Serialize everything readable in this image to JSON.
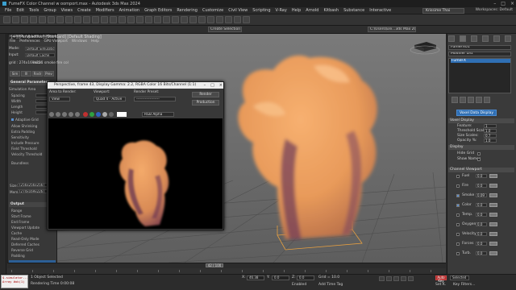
{
  "app": {
    "title": "FumeFX Color Channel w oomport.max - Autodesk 3ds Max 2024",
    "menu": [
      "File",
      "Edit",
      "Tools",
      "Group",
      "Views",
      "Create",
      "Modifiers",
      "Animation",
      "Graph Editors",
      "Rendering",
      "Customize",
      "Civil View",
      "Scripting",
      "V-Ray",
      "Help",
      "Arnold",
      "Kitbash",
      "Substance",
      "Interactive"
    ],
    "signin": "Krissime Thai",
    "workspace": "Workspaces: Default",
    "selection_set": "Create Selection Se",
    "project_path": "C:\\Users\\Ele...3ds Max 2024"
  },
  "viewport": {
    "label": "[+] [Perspective] [Standard] [Default Shading]"
  },
  "fumefx": {
    "title": "FumeFX 7.0 Core | FumeFX01",
    "menu": [
      "File",
      "Preferences",
      "GPU Viewport",
      "Windows",
      "Help"
    ],
    "mode_label": "Mode:",
    "mode_value": "Default Simulation",
    "input_label": "Input:",
    "input_value": "Default Cache",
    "grid_info": "grid : 274x169x226",
    "data_label": "data : smoke fire col",
    "tabs": [
      "Sim",
      "Ill",
      "Rndr",
      "Prev"
    ],
    "section_general": "General Parameters",
    "sim_area_label": "Simulation Area",
    "params": [
      "Spacing",
      "Width",
      "Length",
      "Height"
    ],
    "adaptive": "Adaptive Grid",
    "params2": [
      "Allow Shrinking",
      "Extra Padding",
      "Sensitivity",
      "Include Pressure",
      "Field Threshold",
      "Velocity Threshold"
    ],
    "boundless": "Boundless",
    "size_label": "Size:",
    "size_value": "[256x256x256]",
    "mem_label": "Mem:",
    "mem_value": "[274x169x226]",
    "section_output": "Output",
    "output_items": [
      "Range",
      "Start Frame",
      "End Frame",
      "Viewport Update",
      "Cache",
      "Read-Only Mode",
      "Deferred Caches",
      "Reverse Grid",
      "Padding"
    ]
  },
  "frame_window": {
    "title": "Perspective, frame 43, Display Gamma: 2.2, RGBA Color 16 Bits/Channel (1:1)",
    "area_label": "Area to Render:",
    "area_value": "View",
    "viewport_label": "Viewport:",
    "viewport_value": "Quad 4 - Active",
    "preset_label": "Render Preset:",
    "preset_value": "-------------------",
    "render_btn": "Render",
    "production": "Production",
    "channel": "RGB Alpha"
  },
  "modifier_panel": {
    "object_name": "FumeFX01",
    "modifier_list": "Modifier List",
    "stack_item": "FumeFX",
    "button": "Voxel Data Display",
    "section_voxel": "Voxel Display",
    "voxel_params": [
      {
        "label": "Feature:",
        "value": "1"
      },
      {
        "label": "Threshold Scales:",
        "value": "1.0"
      },
      {
        "label": "Size Scales:",
        "value": "0.7"
      },
      {
        "label": "Opacity %:",
        "value": "1.0"
      }
    ],
    "section_display": "Display",
    "display_items": [
      "Hide Grid",
      "Show Names"
    ],
    "section_channel": "Channel Viewport",
    "channels": [
      {
        "label": "Fuel",
        "value": "0.0"
      },
      {
        "label": "Fire",
        "value": "0.0"
      },
      {
        "label": "Smoke",
        "value": "0.09"
      },
      {
        "label": "Color",
        "value": "0.0"
      },
      {
        "label": "Temp.",
        "value": "0.0"
      },
      {
        "label": "Oxygen",
        "value": "0.0"
      },
      {
        "label": "Velocity",
        "value": "0.0"
      },
      {
        "label": "Forces",
        "value": "0.0"
      },
      {
        "label": "Turb.",
        "value": "0.0"
      }
    ]
  },
  "timeline": {
    "slider": "42 / 100",
    "ticks": [
      "0",
      "5",
      "10",
      "15",
      "20",
      "25",
      "30",
      "35",
      "40",
      "45",
      "50",
      "55",
      "60",
      "65",
      "70",
      "75",
      "80",
      "85",
      "90",
      "95",
      "100"
    ]
  },
  "status": {
    "maxscript": [
      "$.simulator...",
      "Array #ok(1)"
    ],
    "selected": "1 Object Selected",
    "rendering_time": "Rendering Time 0:00:08",
    "x_label": "X:",
    "x_value": "46.38",
    "y_label": "Y:",
    "y_value": "0.0",
    "z_label": "Z:",
    "z_value": "0.0",
    "grid": "Grid = 10.0",
    "add_tag": "Add Time Tag",
    "autokey": "Auto Key",
    "setkey": "Set K.",
    "selected_mode": "Selected",
    "key_filters": "Key Filters...",
    "enabled": "Enabled"
  },
  "colors": {
    "smoke": "#f2a060",
    "smoke_shadow": "#7a3f56",
    "accent": "#2f6fb4"
  }
}
